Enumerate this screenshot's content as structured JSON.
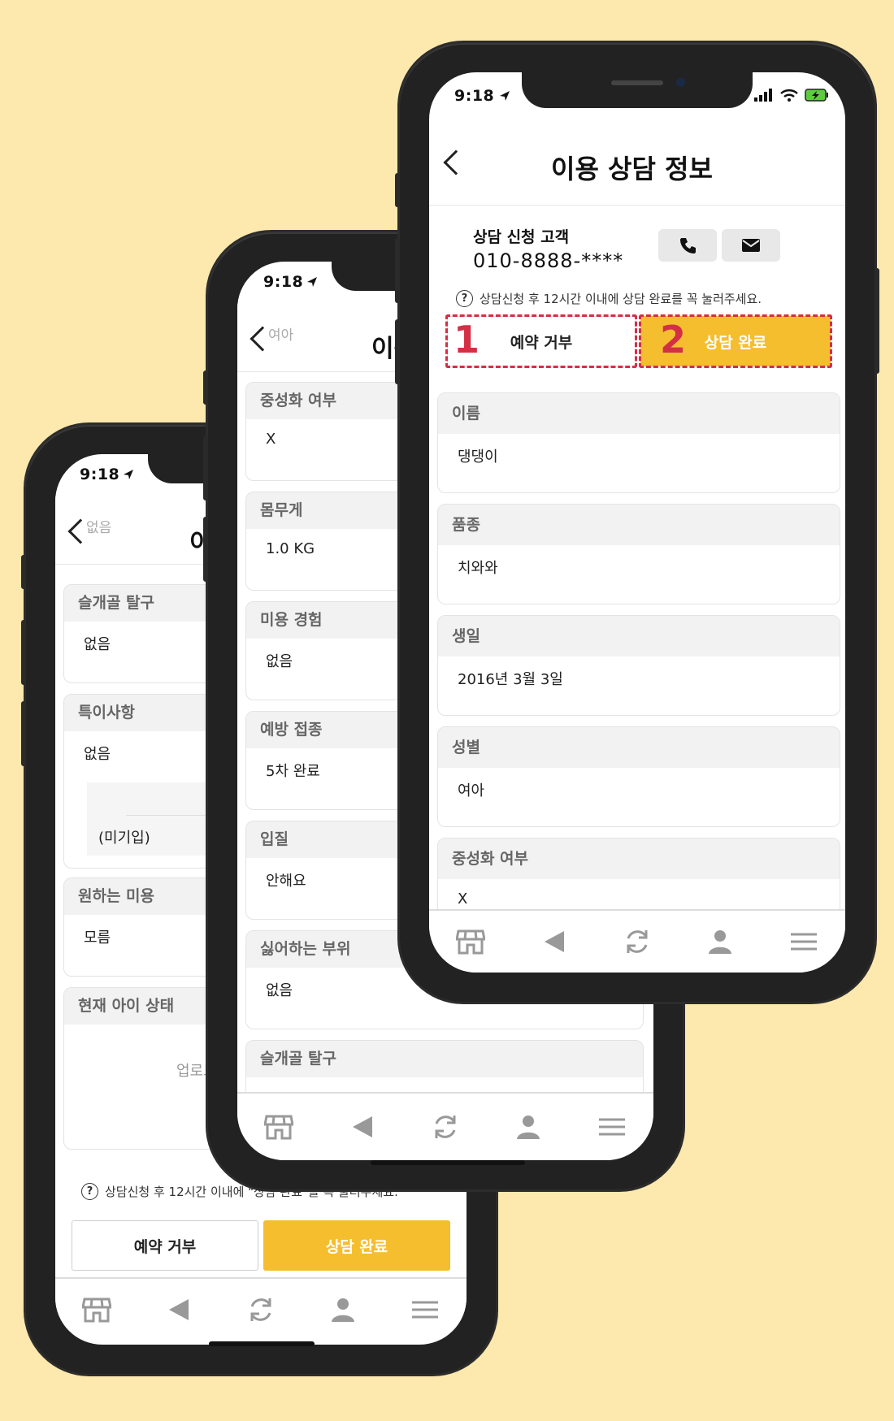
{
  "status_time": "9:18",
  "left_phone": {
    "nav_back_label": "없음",
    "nav_title_partial": "이",
    "cards": [
      {
        "label": "슬개골 탈구",
        "value": "없음"
      },
      {
        "label": "특이사항",
        "value": "없음",
        "extra": "(미기입)"
      },
      {
        "label": "원하는 미용",
        "value": "모름"
      },
      {
        "label": "현재 아이 상태",
        "value": "업로드"
      }
    ],
    "hint": "상담신청 후 12시간 이내에 \"상담 완료\"를 꼭 눌러주세요.",
    "reject_label": "예약 거부",
    "done_label": "상담 완료"
  },
  "middle_phone": {
    "nav_back_label": "여아",
    "nav_title_partial": "이용",
    "cards": [
      {
        "label": "중성화 여부",
        "value": "X"
      },
      {
        "label": "몸무게",
        "value": "1.0 KG"
      },
      {
        "label": "미용 경험",
        "value": "없음"
      },
      {
        "label": "예방 접종",
        "value": "5차 완료"
      },
      {
        "label": "입질",
        "value": "안해요"
      },
      {
        "label": "싫어하는 부위",
        "value": "없음"
      },
      {
        "label": "슬개골 탈구",
        "value": ""
      }
    ]
  },
  "right_phone": {
    "nav_title": "이용 상담 정보",
    "customer_label": "상담 신청 고객",
    "customer_phone": "010-8888-****",
    "hint": "상담신청 후 12시간 이내에 상담 완료를 꼭 눌러주세요.",
    "reject_label": "예약 거부",
    "done_label": "상담 완료",
    "step1": "1",
    "step2": "2",
    "cards": [
      {
        "label": "이름",
        "value": "댕댕이"
      },
      {
        "label": "품종",
        "value": "치와와"
      },
      {
        "label": "생일",
        "value": "2016년 3월 3일"
      },
      {
        "label": "성별",
        "value": "여아"
      },
      {
        "label": "중성화 여부",
        "value": "X"
      }
    ]
  },
  "tab_icons": [
    "shop-icon",
    "back-arrow-icon",
    "refresh-icon",
    "user-icon",
    "menu-icon"
  ],
  "colors": {
    "accent": "#f4be2e",
    "highlight": "#d32f45",
    "background": "#fde8ae"
  }
}
